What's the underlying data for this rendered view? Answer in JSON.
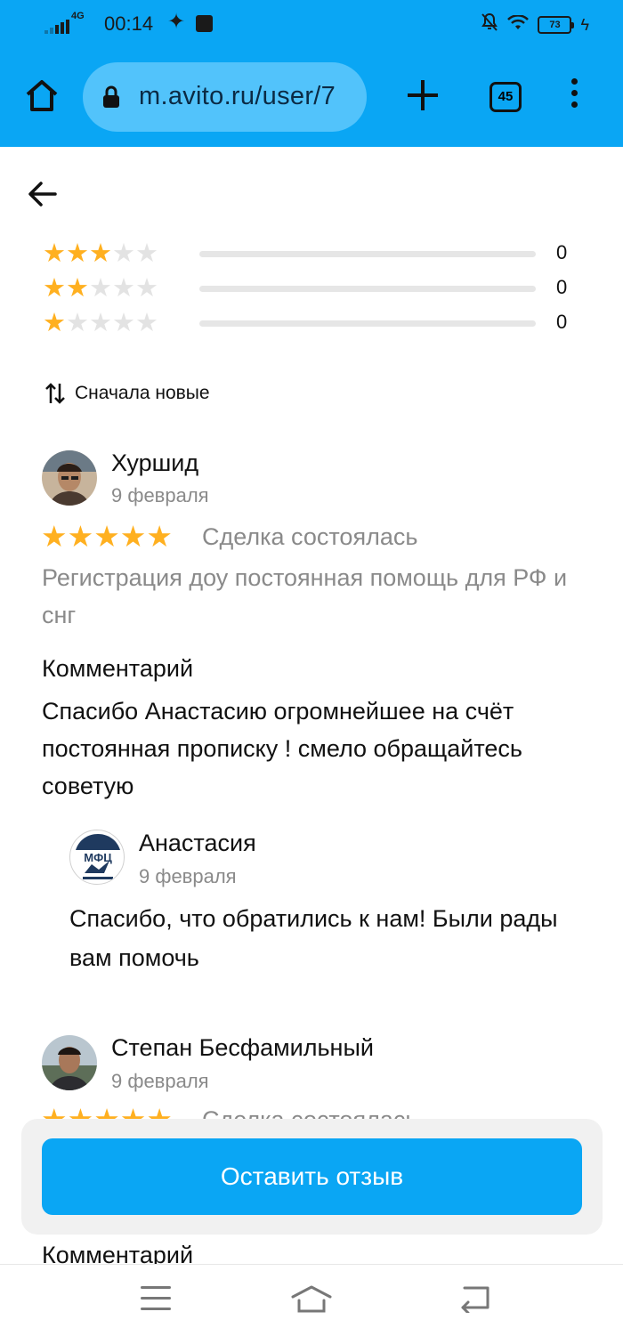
{
  "status_bar": {
    "network": "4G",
    "time": "00:14",
    "battery": "73"
  },
  "browser": {
    "url": "m.avito.ru/user/7",
    "tab_count": "45"
  },
  "rating_breakdown": [
    {
      "stars": 3,
      "count": "0",
      "fill": 0
    },
    {
      "stars": 2,
      "count": "0",
      "fill": 0
    },
    {
      "stars": 1,
      "count": "0",
      "fill": 0
    }
  ],
  "sort": {
    "label": "Сначала новые"
  },
  "reviews": [
    {
      "name": "Хуршид",
      "date": "9 февраля",
      "stars": 5,
      "deal_status": "Сделка состоялась",
      "service": "Регистрация доу постоянная помощь для РФ и снг",
      "comment_heading": "Комментарий",
      "comment": "Спасибо Анастасию огромнейшее на счёт постоянная прописку ! смело обращайтесь советую",
      "reply": {
        "name": "Анастасия",
        "date": "9 февраля",
        "logo_text": "МФЦ",
        "text": "Спасибо, что обратились к нам! Были рады вам помочь"
      }
    },
    {
      "name": "Степан Бесфамильный",
      "date": "9 февраля",
      "stars": 5,
      "deal_status": "Сделка состоялась",
      "comment_heading": "Комментарий"
    }
  ],
  "actions": {
    "leave_review": "Оставить отзыв"
  },
  "colors": {
    "brand_blue": "#0aa6f4",
    "star": "#ffb020",
    "star_off": "#e3e3e3",
    "muted_text": "#8a8a8a"
  }
}
